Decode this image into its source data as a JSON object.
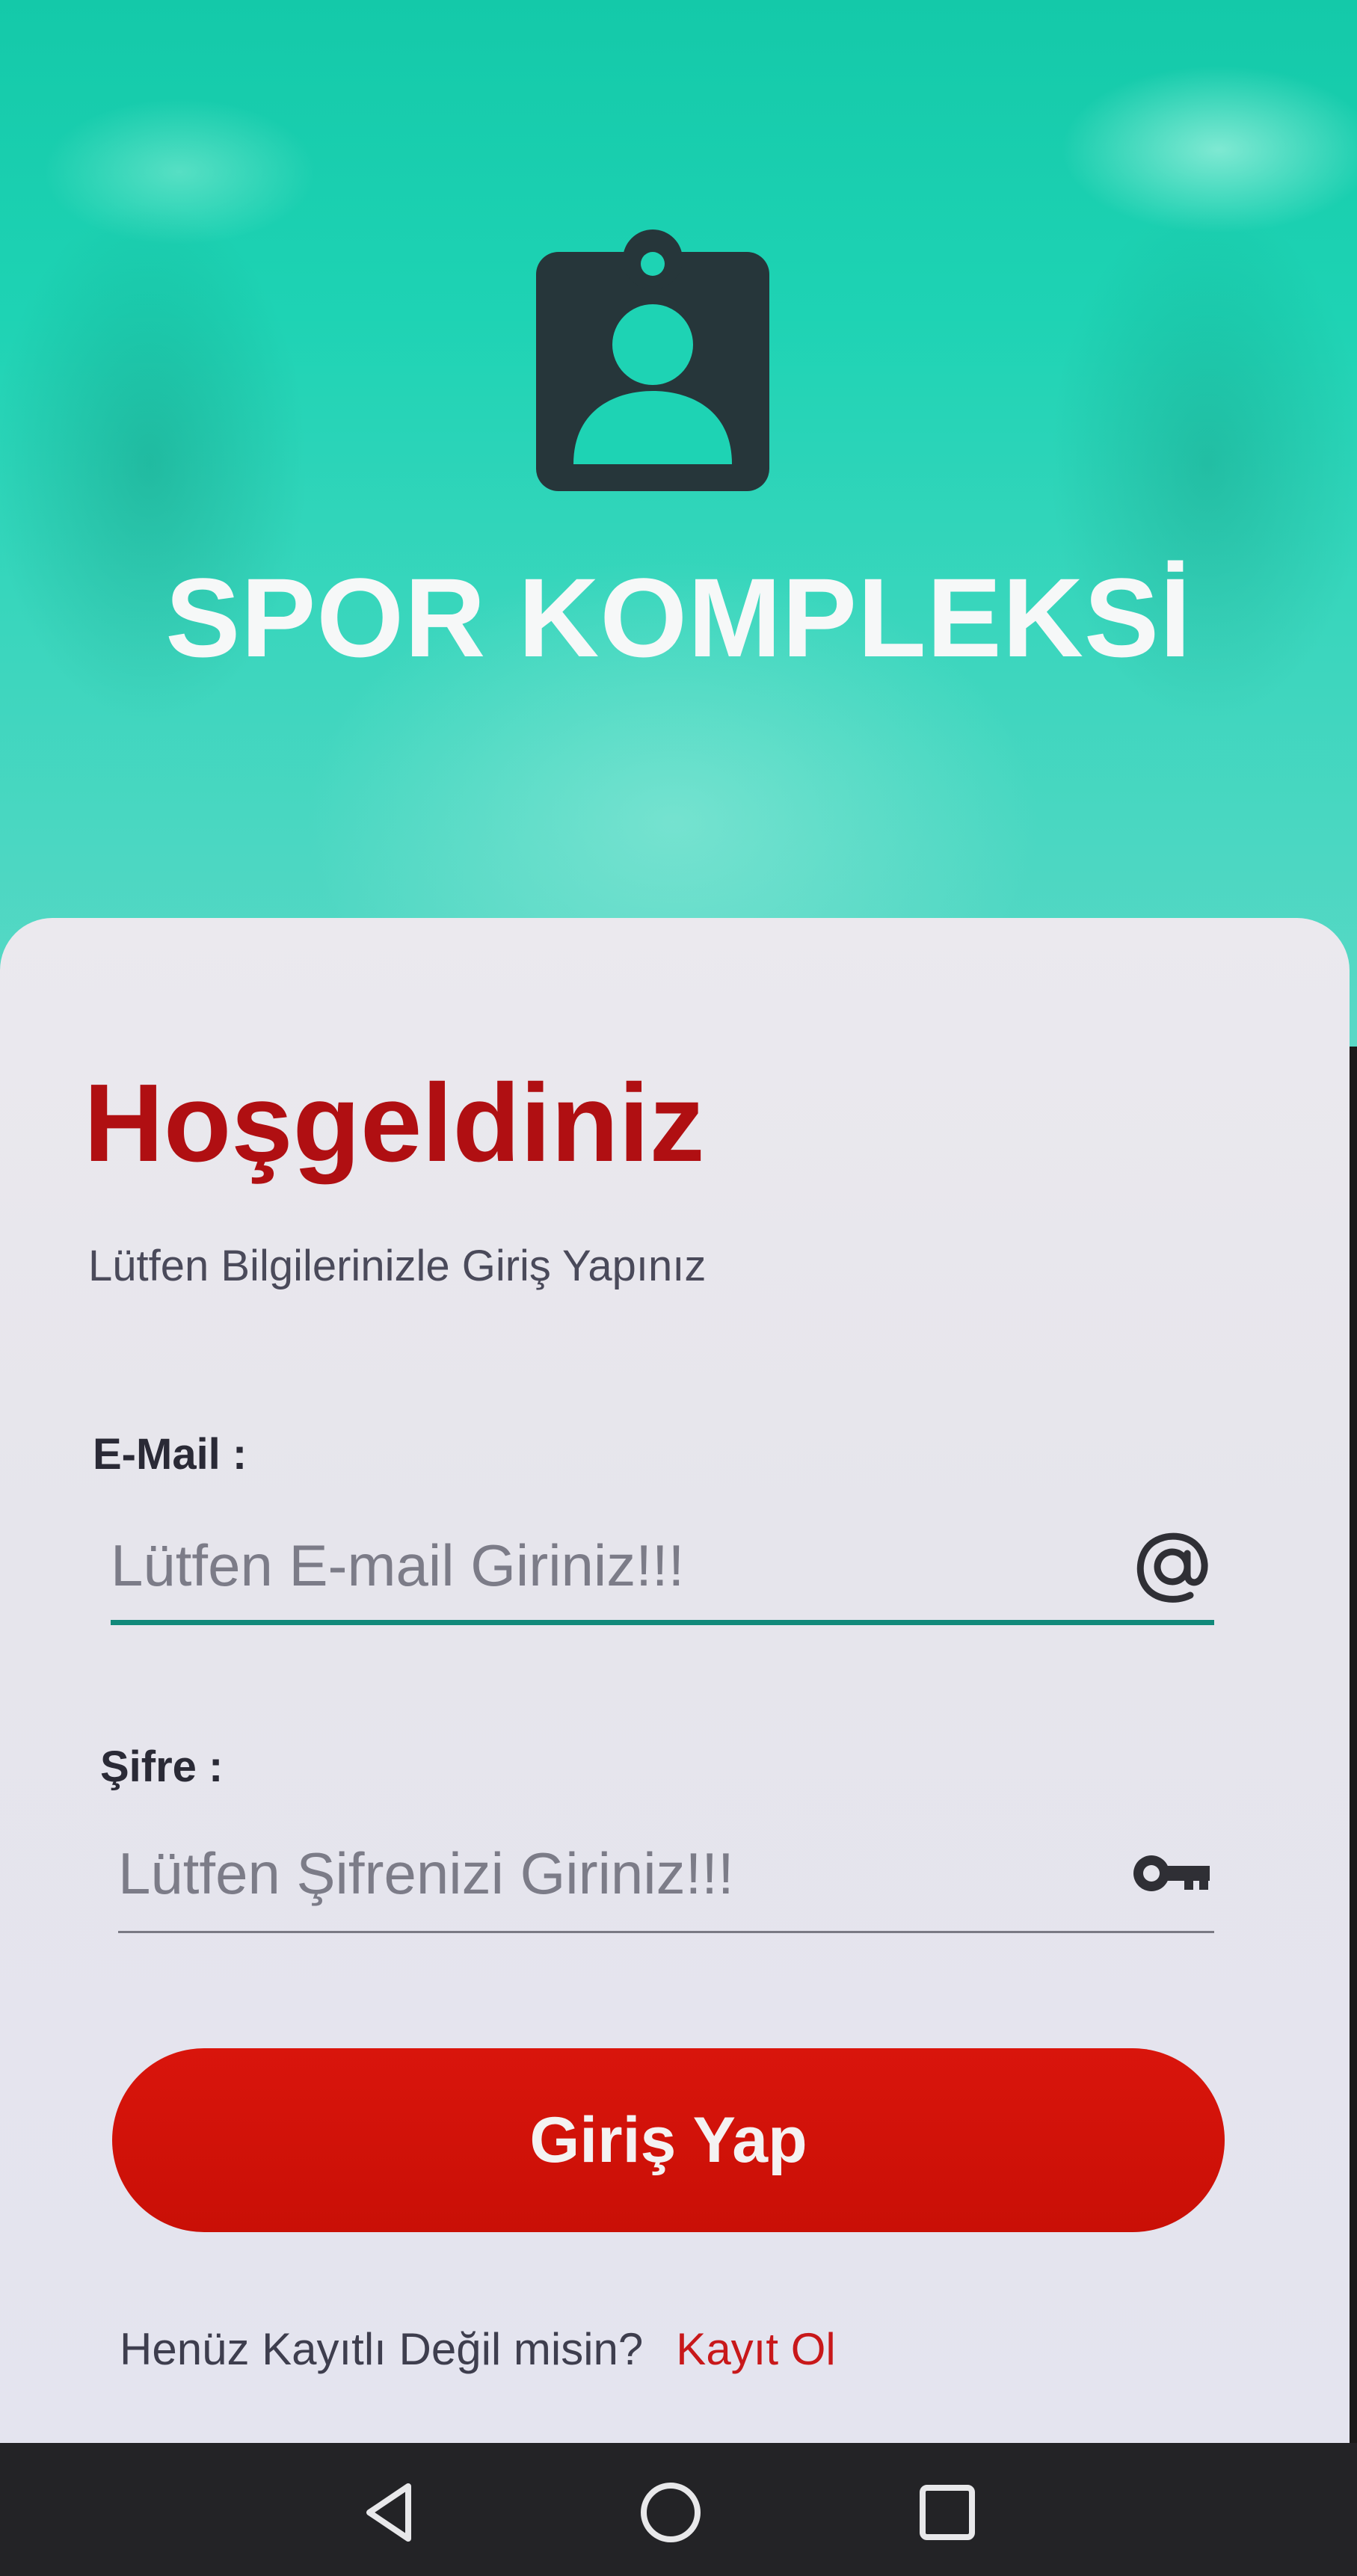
{
  "header": {
    "app_title": "SPOR KOMPLEKSİ",
    "logo_icon": "id-badge-icon"
  },
  "login": {
    "welcome": "Hoşgeldiniz",
    "subtitle": "Lütfen Bilgilerinizle Giriş Yapınız",
    "email_label": "E-Mail :",
    "email_placeholder": "Lütfen E-mail Giriniz!!!",
    "email_icon": "at-sign-icon",
    "password_label": "Şifre :",
    "password_placeholder": "Lütfen Şifrenizi Giriniz!!!",
    "password_icon": "key-icon",
    "submit_label": "Giriş Yap",
    "register_prompt": "Henüz Kayıtlı Değil misin?",
    "register_link": "Kayıt Ol"
  },
  "nav": {
    "back_icon": "back-triangle-icon",
    "home_icon": "home-circle-icon",
    "recents_icon": "recents-square-icon"
  },
  "colors": {
    "hero": "#1ed3b4",
    "accent_red": "#c90f06",
    "title_red": "#b00f12",
    "active_underline": "#11897a"
  }
}
